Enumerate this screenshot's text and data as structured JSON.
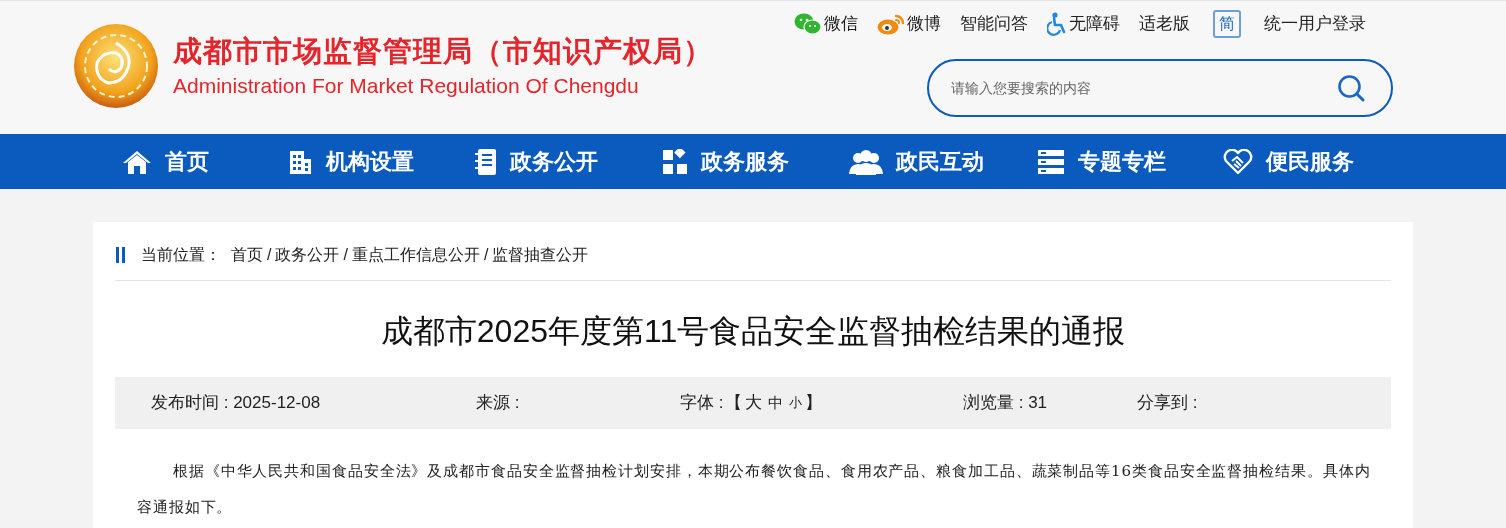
{
  "site": {
    "title": "成都市市场监督管理局（市知识产权局）",
    "subtitle": "Administration For Market Regulation Of Chengdu"
  },
  "top_links": [
    {
      "label": "微信",
      "kind": "wechat"
    },
    {
      "label": "微博",
      "kind": "weibo"
    },
    {
      "label": "智能问答",
      "kind": "plain"
    },
    {
      "label": "无障碍",
      "kind": "accessibility"
    },
    {
      "label": "适老版",
      "kind": "plain"
    },
    {
      "label": "简",
      "kind": "boxed"
    },
    {
      "label": "统一用户登录",
      "kind": "plain"
    }
  ],
  "search": {
    "placeholder": "请输入您要搜索的内容"
  },
  "nav": [
    {
      "label": "首页"
    },
    {
      "label": "机构设置"
    },
    {
      "label": "政务公开"
    },
    {
      "label": "政务服务"
    },
    {
      "label": "政民互动"
    },
    {
      "label": "专题专栏"
    },
    {
      "label": "便民服务"
    }
  ],
  "breadcrumb": {
    "label": "当前位置：",
    "items": [
      "首页",
      "政务公开",
      "重点工作信息公开",
      "监督抽查公开"
    ],
    "separator": "/"
  },
  "article": {
    "title": "成都市2025年度第11号食品安全监督抽检结果的通报",
    "meta": {
      "published": "发布时间 : 2025-12-08",
      "source": "来源 :",
      "font_label": "字体 :",
      "font_open": "【",
      "font_sizes": [
        "大",
        "中",
        "小"
      ],
      "font_close": "】",
      "views": "浏览量 : 31",
      "share": "分享到 :"
    },
    "body": "根据《中华人民共和国食品安全法》及成都市食品安全监督抽检计划安排，本期公布餐饮食品、食用农产品、粮食加工品、蔬菜制品等16类食品安全监督抽检结果。具体内容通报如下。"
  }
}
